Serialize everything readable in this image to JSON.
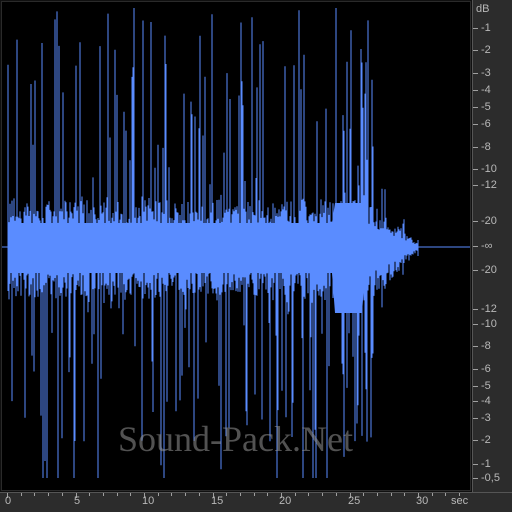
{
  "colors": {
    "waveform": "#5a8cff",
    "background": "#000000",
    "ruler": "#2c2c2c",
    "ruler_text": "#b8b8b8",
    "watermark": "#969696"
  },
  "db_ruler": {
    "unit": "dB",
    "top_labels": [
      "-1",
      "-2",
      "-3",
      "-4",
      "-5",
      "-6",
      "-8",
      "-10",
      "-12",
      "-20"
    ],
    "center_label": "-∞",
    "bottom_labels": [
      "-20",
      "-12",
      "-10",
      "-8",
      "-6",
      "-5",
      "-4",
      "-3",
      "-2",
      "-1",
      "-0,5"
    ]
  },
  "time_ruler": {
    "unit": "sec",
    "labels": [
      "0",
      "5",
      "10",
      "15",
      "20",
      "25",
      "30"
    ]
  },
  "waveform": {
    "duration_sec": 33,
    "sound_end_sec": 30,
    "dense_until_sec": 26
  },
  "watermark": "Sound-Pack.Net"
}
